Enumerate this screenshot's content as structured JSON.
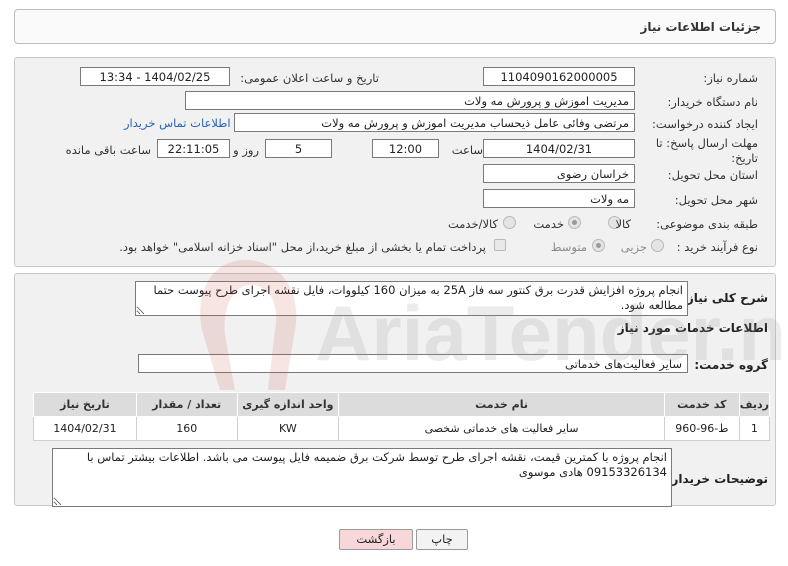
{
  "header": {
    "title": "جزئیات اطلاعات نیاز"
  },
  "form": {
    "need_number_label": "شماره نیاز:",
    "need_number": "1104090162000005",
    "announce_label": "تاریخ و ساعت اعلان عمومی:",
    "announce_value": "1404/02/25 - 13:34",
    "buyer_org_label": "نام دستگاه خریدار:",
    "buyer_org": "مدیریت اموزش و پرورش مه ولات",
    "creator_label": "ایجاد کننده درخواست:",
    "creator": "مرتضی وفائی عامل ذیحساب مدیریت اموزش و پرورش مه ولات",
    "contact_link": "اطلاعات تماس خریدار",
    "deadline_label_1": "مهلت ارسال پاسخ: تا",
    "deadline_label_2": "تاریخ:",
    "deadline_date": "1404/02/31",
    "time_label": "ساعت",
    "deadline_time": "12:00",
    "days_value": "5",
    "days_label": "روز و",
    "remaining_time": "22:11:05",
    "remaining_label": "ساعت باقی مانده",
    "province_label": "استان محل تحویل:",
    "province": "خراسان رضوی",
    "city_label": "شهر محل تحویل:",
    "city": "مه ولات",
    "category_label": "طبقه بندی موضوعی:",
    "category_options": [
      "کالا",
      "خدمت",
      "کالا/خدمت"
    ],
    "category_selected": "خدمت",
    "process_label": "نوع فرآیند خرید :",
    "process_options": [
      "جزیی",
      "متوسط"
    ],
    "process_selected": "متوسط",
    "payment_note": "پرداخت تمام یا بخشی از مبلغ خرید،از محل \"اسناد خزانه اسلامی\" خواهد بود."
  },
  "summary": {
    "label": "شرح کلی نیاز:",
    "text": "انجام پروژه افزایش قدرت برق کنتور سه فاز 25A به میزان 160 کیلووات، فایل نقشه اجرای طرح پیوست حتما مطالعه شود."
  },
  "services": {
    "title": "اطلاعات خدمات مورد نیاز",
    "group_label": "گروه خدمت:",
    "group_value": "سایر فعالیت‌های خدماتی",
    "columns": [
      "ردیف",
      "کد خدمت",
      "نام خدمت",
      "واحد اندازه گیری",
      "تعداد / مقدار",
      "تاریخ نیاز"
    ],
    "rows": [
      {
        "row": "1",
        "code": "ط-96-960",
        "name": "سایر فعالیت های خدماتی شخصی",
        "unit": "KW",
        "qty": "160",
        "date": "1404/02/31"
      }
    ]
  },
  "buyer_notes": {
    "label": "توضیحات خریدار:",
    "text": "انجام پروژه با کمترین قیمت، نقشه اجرای طرح توسط شرکت برق ضمیمه فایل پیوست می باشد. اطلاعات بیشتر تماس با 09153326134 هادی موسوی"
  },
  "buttons": {
    "print": "چاپ",
    "back": "بازگشت"
  },
  "watermark": {
    "text": "AriaTender.neT"
  },
  "colors": {
    "link": "#2a62b8",
    "back_button": "#f7d7d7",
    "print_button": "#f3f3f3"
  }
}
